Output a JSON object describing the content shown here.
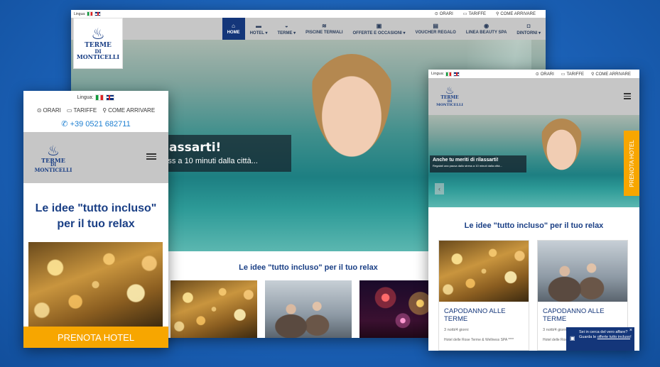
{
  "desktop": {
    "lang_label": "Lingua:",
    "utility": [
      {
        "icon": "clock-icon",
        "glyph": "⊙",
        "label": "ORARI"
      },
      {
        "icon": "ticket-icon",
        "glyph": "▭",
        "label": "TARIFFE"
      },
      {
        "icon": "map-pin-icon",
        "glyph": "⚲",
        "label": "COME ARRIVARE"
      }
    ],
    "nav": [
      {
        "label": "HOME",
        "icon": "home-icon",
        "glyph": "⌂",
        "active": true
      },
      {
        "label": "HOTEL ▾",
        "icon": "bed-icon",
        "glyph": "▬"
      },
      {
        "label": "TERME ▾",
        "icon": "spa-icon",
        "glyph": "◒"
      },
      {
        "label": "PISCINE TERMALI",
        "icon": "swimmer-icon",
        "glyph": "≋"
      },
      {
        "label": "OFFERTE E OCCASIONI ▾",
        "icon": "offer-icon",
        "glyph": "▣"
      },
      {
        "label": "VOUCHER REGALO",
        "icon": "gift-icon",
        "glyph": "▤"
      },
      {
        "label": "LINEA BEAUTY SPA",
        "icon": "beauty-icon",
        "glyph": "◉"
      },
      {
        "label": "DINTORNI ▾",
        "icon": "camera-icon",
        "glyph": "◘"
      }
    ],
    "hero_title": "rilassarti!",
    "hero_subtitle": "stress a 10 minuti dalla città...",
    "section_title": "Le idee \"tutto incluso\" per il tuo relax"
  },
  "logo": {
    "line1": "TERME",
    "line2": "DI",
    "line3": "MONTICELLI"
  },
  "mobile": {
    "lang_label": "Lingua:",
    "utility": [
      {
        "icon": "clock-icon",
        "glyph": "⊙",
        "label": "ORARI"
      },
      {
        "icon": "ticket-icon",
        "glyph": "▭",
        "label": "TARIFFE"
      },
      {
        "icon": "map-pin-icon",
        "glyph": "⚲",
        "label": "COME ARRIVARE"
      }
    ],
    "phone": "+39 0521 682711",
    "section_title": "Le idee \"tutto incluso\" per il tuo relax",
    "book_button": "PRENOTA HOTEL"
  },
  "tablet": {
    "lang_label": "Lingua:",
    "utility": [
      {
        "icon": "clock-icon",
        "glyph": "⊙",
        "label": "ORARI"
      },
      {
        "icon": "ticket-icon",
        "glyph": "▭",
        "label": "TARIFFE"
      },
      {
        "icon": "map-pin-icon",
        "glyph": "⚲",
        "label": "COME ARRIVARE"
      }
    ],
    "hero_title": "Anche tu meriti di rilassarti!",
    "hero_subtitle": "Regalati una pausa dallo stress a 10 minuti dalla città...",
    "side_button": "PRENOTA HOTEL",
    "section_title": "Le idee \"tutto incluso\" per il tuo relax",
    "cards": [
      {
        "title": "CAPODANNO ALLE TERME",
        "duration": "3 notti/4 giorni",
        "hotel": "Hotel delle Rose Terme & Wellness SPA ****"
      },
      {
        "title": "CAPODANNO ALLE TERME",
        "duration": "3 notti/4 giorni",
        "hotel": "Hotel delle Rose Terme & Wellness SPA ****"
      }
    ],
    "popup": {
      "line1": "Sei in cerca del vero affare?",
      "line2": "Guarda le",
      "link": "offerte tutto incluso",
      "end": "!",
      "close": "×"
    }
  },
  "colors": {
    "brand_blue": "#14367a",
    "accent_orange": "#f7a600",
    "background": "#1a5fb4"
  }
}
